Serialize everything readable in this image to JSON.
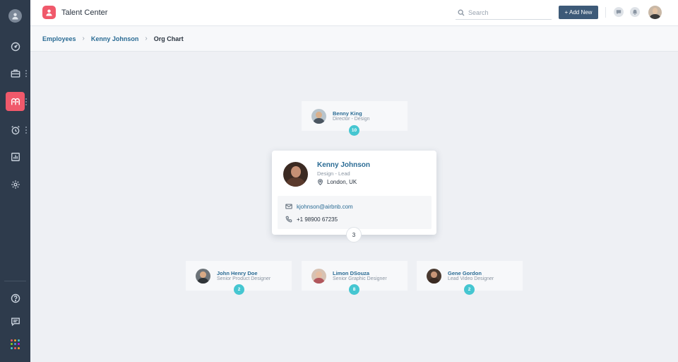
{
  "app": {
    "title": "Talent Center"
  },
  "header": {
    "search_placeholder": "Search",
    "add_new_label": "+ Add New"
  },
  "breadcrumb": {
    "items": [
      "Employees",
      "Kenny Johnson"
    ],
    "current": "Org Chart",
    "separator": "›"
  },
  "sidebar": {
    "items": [
      {
        "icon": "dashboard-icon",
        "active": false
      },
      {
        "icon": "briefcase-icon",
        "active": false
      },
      {
        "icon": "people-icon",
        "active": true
      },
      {
        "icon": "alarm-clock-icon",
        "active": false
      },
      {
        "icon": "reports-icon",
        "active": false
      },
      {
        "icon": "gear-icon",
        "active": false
      }
    ],
    "bottom": [
      "help-icon",
      "chat-icon",
      "apps-grid-icon"
    ]
  },
  "manager": {
    "name": "Benny King",
    "role": "Director - Design",
    "count": "10"
  },
  "employee": {
    "name": "Kenny Johnson",
    "role": "Design - Lead",
    "location": "London, UK",
    "email": "kjohnson@airbnb.com",
    "phone": "+1 98900 67235",
    "reports_count": "3"
  },
  "reports": [
    {
      "name": "John Henry Doe",
      "role": "Senior Product Designer",
      "count": "2"
    },
    {
      "name": "Limon DSouza",
      "role": "Senior Graphic Designer",
      "count": "8"
    },
    {
      "name": "Gene Gordon",
      "role": "Lead Video Designer",
      "count": "2"
    }
  ],
  "colors": {
    "accent": "#f0596b",
    "sidebar": "#2e3b4c",
    "link": "#2a6b94",
    "badge": "#45c6d1",
    "button": "#3d5a78"
  }
}
